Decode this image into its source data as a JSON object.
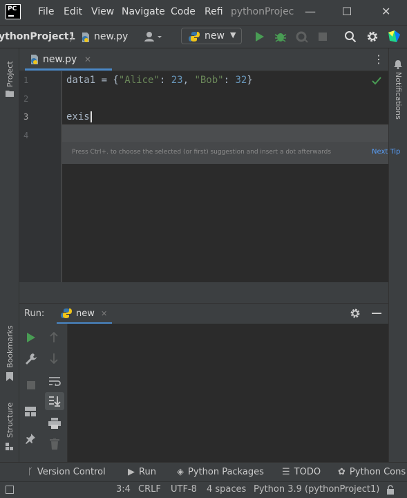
{
  "app": {
    "logo_text": "PC"
  },
  "menu": {
    "file": "File",
    "edit": "Edit",
    "view": "View",
    "navigate": "Navigate",
    "code": "Code",
    "refactor": "Refi",
    "window_title": "pythonProjec"
  },
  "window_controls": {
    "minimize": "—",
    "maximize": "☐",
    "close": "✕"
  },
  "breadcrumb": {
    "project": "ythonProject1",
    "separator": "〉",
    "file": "new.py"
  },
  "run_config": {
    "name": "new"
  },
  "editor_tab": {
    "label": "new.py",
    "close": "✕"
  },
  "editor": {
    "line_numbers": [
      "1",
      "2",
      "3",
      "4"
    ],
    "line1": {
      "var": "data1 = {",
      "k1": "\"Alice\"",
      "sep1": ": ",
      "v1": "23",
      "comma": ", ",
      "k2": "\"Bob\"",
      "sep2": ": ",
      "v2": "32",
      "end": "}"
    },
    "line3": "exis",
    "popup_hint": "Press Ctrl+. to choose the selected (or first) suggestion and insert a dot afterwards",
    "popup_tip": "Next Tip"
  },
  "left_strip": {
    "project": "Project",
    "bookmarks": "Bookmarks",
    "structure": "Structure"
  },
  "right_strip": {
    "notifications": "Notifications"
  },
  "run_panel": {
    "label": "Run:",
    "tab": "new",
    "tab_close": "✕"
  },
  "bottom_tools": [
    {
      "label": "Version Control"
    },
    {
      "label": "Run"
    },
    {
      "label": "Python Packages"
    },
    {
      "label": "TODO"
    },
    {
      "label": "Python Cons"
    }
  ],
  "status": {
    "position": "3:4",
    "line_sep": "CRLF",
    "encoding": "UTF-8",
    "indent": "4 spaces",
    "interpreter": "Python 3.9 (pythonProject1)"
  },
  "colors": {
    "accent": "#4a88c7",
    "run_green": "#499c54",
    "string": "#6a8759",
    "number": "#6897bb"
  }
}
